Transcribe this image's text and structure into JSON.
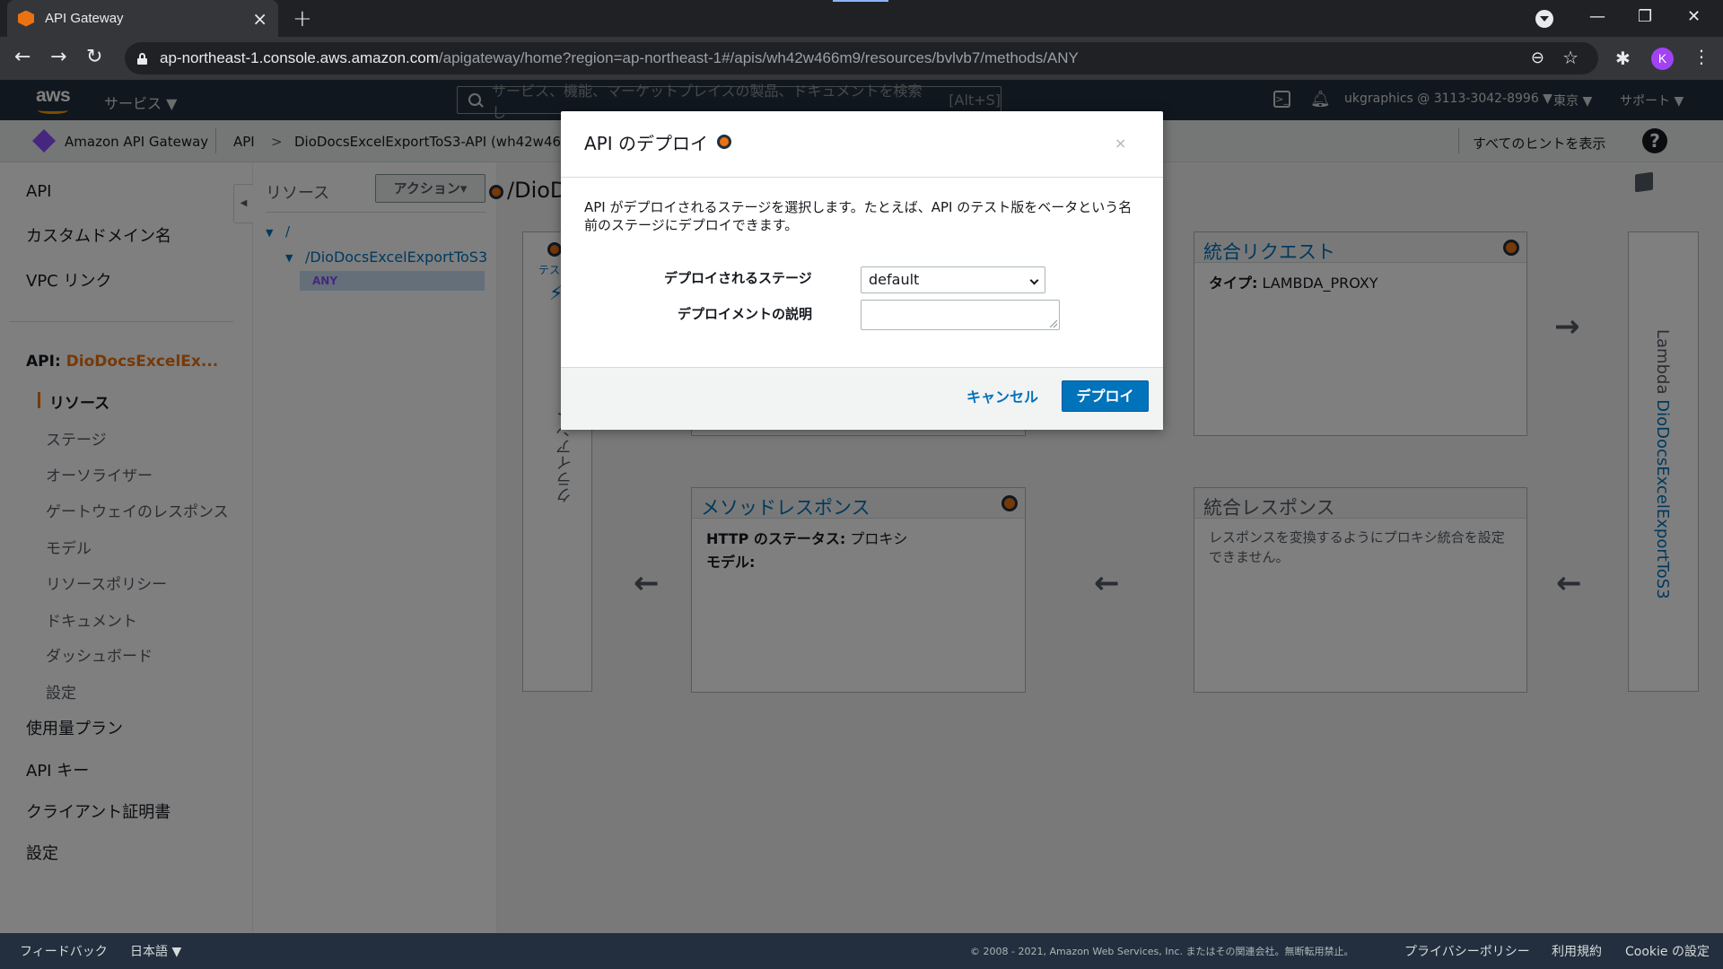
{
  "browser": {
    "tab_title": "API Gateway",
    "tab_close": "×",
    "new_tab": "+",
    "url_host": "ap-northeast-1.console.aws.amazon.com",
    "url_path": "/apigateway/home?region=ap-northeast-1#/apis/wh42w466m9/resources/bvlvb7/methods/ANY",
    "avatar_letter": "K",
    "icons": [
      "back-icon",
      "forward-icon",
      "reload-icon",
      "lock-icon",
      "zoom-icon",
      "star-icon",
      "extensions-icon",
      "menu-icon"
    ]
  },
  "aws_nav": {
    "logo": "aws",
    "services": "サービス ▼",
    "search_placeholder": "サービス、機能、マーケットプレイスの製品、ドキュメントを検索し",
    "search_shortcut": "[Alt+S]",
    "account": "ukgraphics @ 3113-3042-8996 ▼",
    "region": "東京 ▼",
    "support": "サポート ▼"
  },
  "service_header": {
    "service_name": "Amazon API Gateway",
    "crumb_api": "API",
    "crumb_sep": ">",
    "crumb_current": "DioDocsExcelExportToS3-API (wh42w466",
    "show_hints": "すべてのヒントを表示",
    "help": "?"
  },
  "sidebar": {
    "top_items": [
      "API",
      "カスタムドメイン名",
      "VPC リンク"
    ],
    "api_prefix": "API: ",
    "api_name": "DioDocsExcelEx...",
    "sub_items": [
      "リソース",
      "ステージ",
      "オーソライザー",
      "ゲートウェイのレスポンス",
      "モデル",
      "リソースポリシー",
      "ドキュメント",
      "ダッシュボード",
      "設定"
    ],
    "bottom_items": [
      "使用量プラン",
      "API キー",
      "クライアント証明書",
      "設定"
    ]
  },
  "tree": {
    "title": "リソース",
    "actions": "アクション▾",
    "root": "/",
    "resource": "/DioDocsExcelExportToS3",
    "method": "ANY"
  },
  "main": {
    "title": "/DioD",
    "client_label": "クライアント",
    "client_test": "テス",
    "method_request_title": "",
    "integration_request_title": "統合リクエスト",
    "integration_request_type_label": "タイプ:",
    "integration_request_type": "LAMBDA_PROXY",
    "method_response_title": "メソッドレスポンス",
    "method_response_status_label": "HTTP のステータス:",
    "method_response_status": "プロキシ",
    "method_response_model_label": "モデル:",
    "integration_response_title": "統合レスポンス",
    "integration_response_text": "レスポンスを変換するようにプロキシ統合を設定できません。",
    "lambda_prefix": "Lambda ",
    "lambda_name": "DioDocsExcelExportToS3"
  },
  "footer": {
    "feedback": "フィードバック",
    "language": "日本語 ▼",
    "copyright": "© 2008 - 2021, Amazon Web Services, Inc. またはその関連会社。無断転用禁止。",
    "privacy": "プライバシーポリシー",
    "terms": "利用規約",
    "cookie": "Cookie の設定"
  },
  "modal": {
    "title": "API のデプロイ",
    "close": "×",
    "description": "API がデプロイされるステージを選択します。たとえば、API のテスト版をベータという名前のステージにデプロイできます。",
    "stage_label": "デプロイされるステージ",
    "stage_value": "default",
    "desc_label": "デプロイメントの説明",
    "desc_value": "",
    "cancel": "キャンセル",
    "deploy": "デプロイ"
  },
  "colors": {
    "aws_nav": "#232f3e",
    "accent_orange": "#ec7211",
    "link_blue": "#0073bb",
    "primary_button": "#0073bb"
  }
}
